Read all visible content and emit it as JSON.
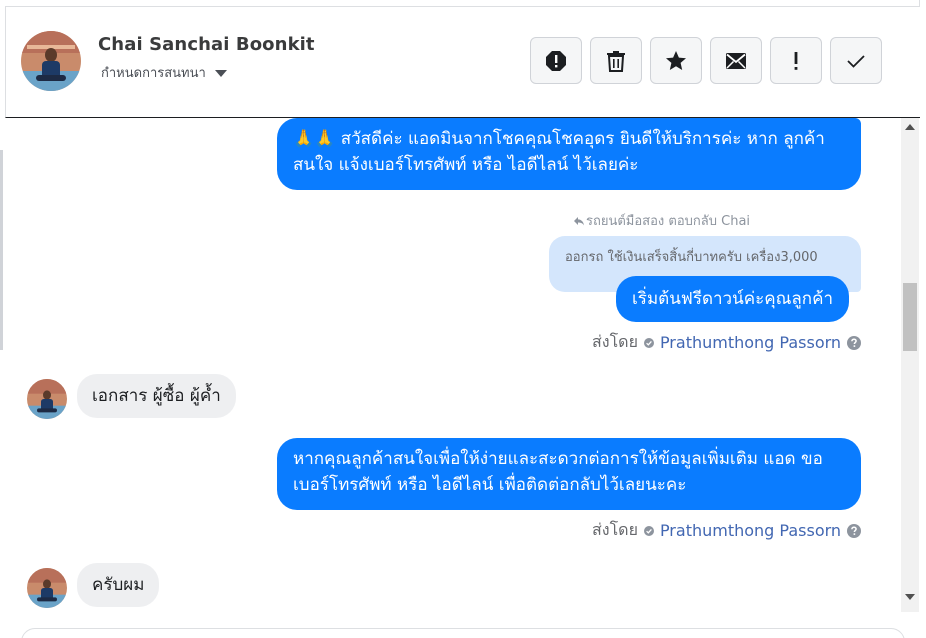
{
  "contact": {
    "name": "Chai Sanchai Boonkit",
    "settings_label": "กำหนดการสนทนา"
  },
  "toolbar": {
    "buttons": [
      {
        "icon": "alert-circle-icon"
      },
      {
        "icon": "trash-icon"
      },
      {
        "icon": "star-icon"
      },
      {
        "icon": "envelope-icon"
      },
      {
        "icon": "exclamation-icon"
      },
      {
        "icon": "checkmark-icon"
      }
    ]
  },
  "messages": {
    "m1": {
      "emoji": "🙏🙏",
      "text": "สวัสดีค่ะ แอดมินจากโชคคุณโชคอุดร ยินดีให้บริการค่ะ หาก ลูกค้า สนใจ แจ้งเบอร์โทรศัพท์ หรือ ไอดีไลน์ ไว้เลยค่ะ"
    },
    "reply_note": "รถยนต์มือสอง ตอบกลับ Chai",
    "reply_quote": "ออกรถ ใช้เงินเสร็จสิ้นกี่บาทครับ เครื่อง3,000",
    "m2": {
      "text": "เริ่มต้นฟรีดาวน์ค่ะคุณลูกค้า"
    },
    "sent_by_1": {
      "label": "ส่งโดย",
      "sender": "Prathumthong Passorn"
    },
    "m3": {
      "text": "เอกสาร ผู้ซื้อ ผู้ค้ำ"
    },
    "m4": {
      "text": "หากคุณลูกค้าสนใจเพื่อให้ง่ายและสะดวกต่อการให้ข้อมูลเพิ่มเติม แอด ขอเบอร์โทรศัพท์ หรือ ไอดีไลน์ เพื่อติดต่อกลับไว้เลยนะคะ"
    },
    "sent_by_2": {
      "label": "ส่งโดย",
      "sender": "Prathumthong Passorn"
    },
    "m5": {
      "text": "ครับผม"
    }
  },
  "colors": {
    "outgoing_bubble": "#0a7cff",
    "incoming_bubble": "#eeeff1",
    "reply_quote_bg": "#d4e6fc",
    "sender_link": "#4267b2"
  }
}
